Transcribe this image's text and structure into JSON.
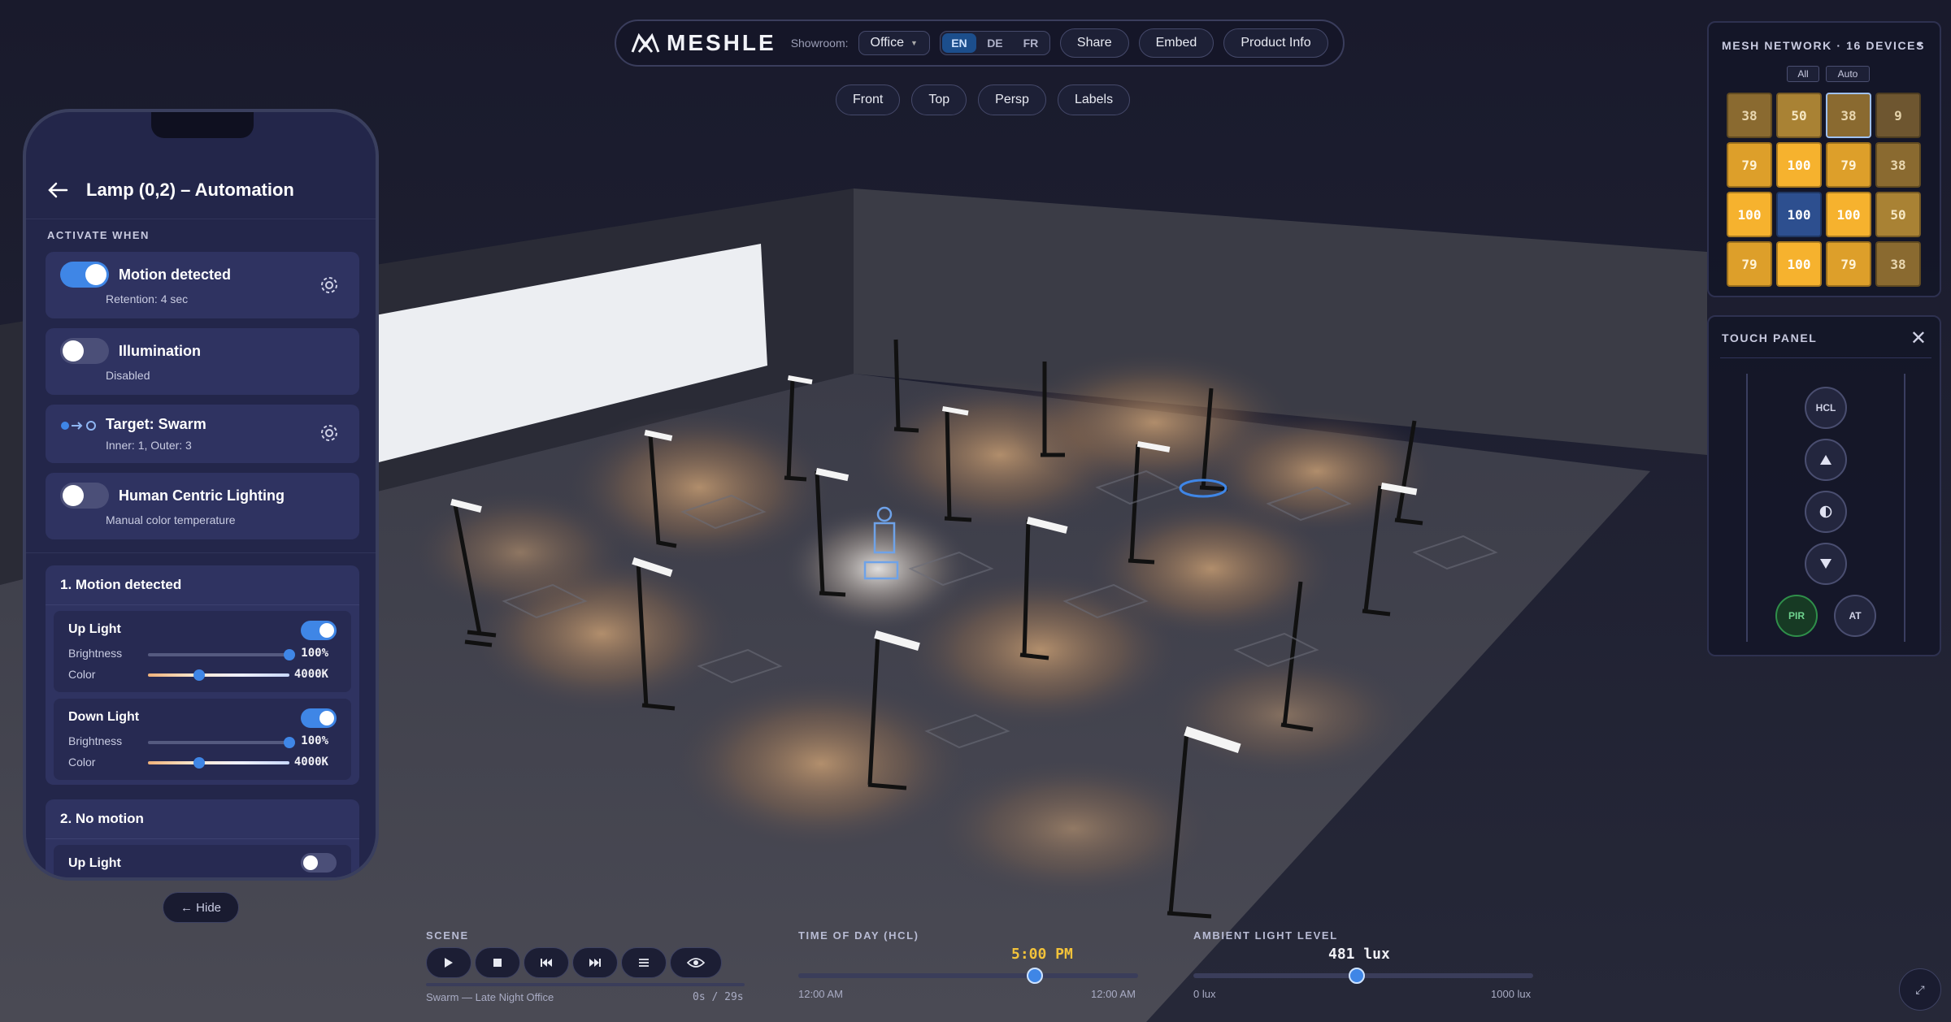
{
  "toolbar": {
    "brand": "MESHLE",
    "showroom_label": "Showroom:",
    "showroom_value": "Office",
    "languages": [
      "EN",
      "DE",
      "FR"
    ],
    "active_language": "EN",
    "share": "Share",
    "embed": "Embed",
    "product_info": "Product Info"
  },
  "views": [
    "Front",
    "Top",
    "Persp",
    "Labels"
  ],
  "phone": {
    "title": "Lamp (0,2) – Automation",
    "activate_label": "ACTIVATE WHEN",
    "triggers": [
      {
        "title": "Motion detected",
        "sub": "Retention: 4 sec",
        "on": true
      },
      {
        "title": "Illumination",
        "sub": "Disabled",
        "on": false
      },
      {
        "title": "Target: Swarm",
        "sub": "Inner: 1, Outer: 3"
      },
      {
        "title": "Human Centric Lighting",
        "sub": "Manual color temperature",
        "on": false
      }
    ],
    "group1": {
      "title": "1. Motion detected",
      "up": {
        "title": "Up Light",
        "brightness_label": "Brightness",
        "brightness": "100%",
        "brightness_level": 1.0,
        "color_label": "Color",
        "color": "4000K",
        "color_level": 0.36
      },
      "down": {
        "title": "Down Light",
        "brightness_label": "Brightness",
        "brightness": "100%",
        "brightness_level": 1.0,
        "color_label": "Color",
        "color": "4000K",
        "color_level": 0.36
      }
    },
    "group2": {
      "title": "2. No motion",
      "up_title": "Up Light"
    }
  },
  "hide_button": "← Hide",
  "mesh": {
    "title": "MESH NETWORK · 16 DEVICES",
    "btn_all": "All",
    "btn_auto": "Auto",
    "cells": [
      "38",
      "50",
      "38",
      "9",
      "79",
      "100",
      "79",
      "38",
      "100",
      "100",
      "100",
      "50",
      "79",
      "100",
      "79",
      "38"
    ],
    "selected_index": 9,
    "highlight_index": 2
  },
  "touch": {
    "title": "TOUCH PANEL",
    "hcl": "HCL",
    "pir": "PIR",
    "at": "AT"
  },
  "bottom": {
    "scene_label": "SCENE",
    "scene_name": "Swarm — Late Night Office",
    "scene_time": "0s / 29s",
    "tod_label": "TIME OF DAY (HCL)",
    "tod_value": "5:00 PM",
    "tod_level": 0.696,
    "tod_min": "12:00 AM",
    "tod_max": "12:00 AM",
    "ambient_label": "AMBIENT LIGHT LEVEL",
    "ambient_value": "481 lux",
    "ambient_level": 0.481,
    "ambient_min": "0 lux",
    "ambient_max": "1000 lux"
  },
  "colors": {
    "accent": "#3f86e6",
    "amber": "#f0a830",
    "tod": "#f2c23a"
  }
}
